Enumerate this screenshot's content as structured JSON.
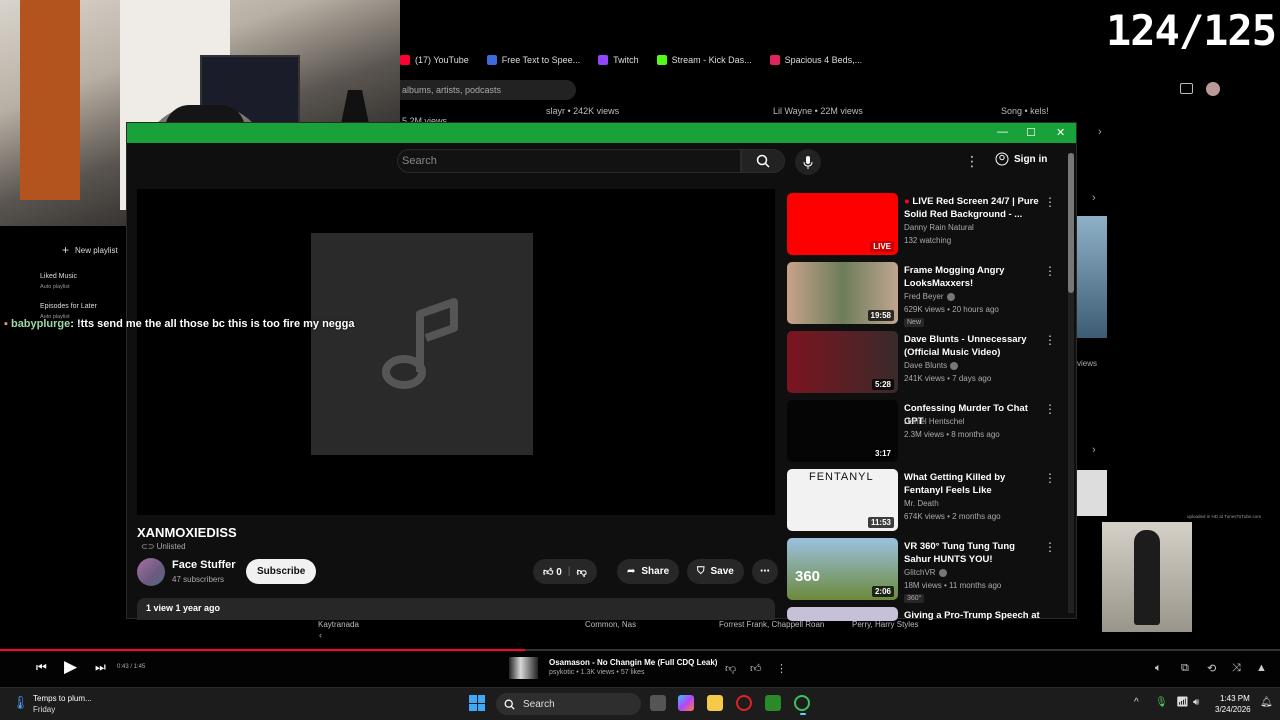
{
  "counter": "124/125",
  "bookmarks": [
    {
      "label": "(17) YouTube",
      "color": "#ff0033"
    },
    {
      "label": "Free Text to Spee...",
      "color": "#3d6bd9"
    },
    {
      "label": "Twitch",
      "color": "#9146ff"
    },
    {
      "label": "Stream - Kick Das...",
      "color": "#53fc18"
    },
    {
      "label": "Spacious 4 Beds,...",
      "color": "#e0245e"
    }
  ],
  "bg_search_placeholder": "albums, artists, podcasts",
  "bg_strip": [
    "slayr • 242K views",
    "Lil Wayne • 22M views",
    "Song • kels!",
    "5.2M views"
  ],
  "window": {
    "search_placeholder": "Search",
    "signin": "Sign in"
  },
  "video": {
    "title": "XANMOXIEDISS",
    "visibility": "Unlisted",
    "channel": "Face Stuffer",
    "subscribers": "47 subscribers",
    "subscribe": "Subscribe",
    "likes": "0",
    "share": "Share",
    "save": "Save",
    "description": "1 view  1 year ago"
  },
  "recommendations": [
    {
      "title": "LIVE Red Screen 24/7 | Pure Solid Red Background - ...",
      "channel": "Danny Rain Natural",
      "meta": "132 watching",
      "badge": "LIVE",
      "thumb": "#ff0000",
      "live": true
    },
    {
      "title": "Frame Mogging Angry LooksMaxxers!",
      "channel": "Fred Beyer",
      "verified": true,
      "meta": "629K views • 20 hours ago",
      "duration": "19:58",
      "badge": "New",
      "thumb": "#7a6a55"
    },
    {
      "title": "Dave Blunts - Unnecessary (Official Music Video)",
      "channel": "Dave Blunts",
      "verified": true,
      "meta": "241K views • 7 days ago",
      "duration": "5:28",
      "thumb": "#7c1420"
    },
    {
      "title": "Confessing Murder To Chat GPT",
      "channel": "Daniel Hentschel",
      "meta": "2.3M views • 8 months ago",
      "duration": "3:17",
      "thumb": "#0a0a0a"
    },
    {
      "title": "What Getting Killed by Fentanyl Feels Like",
      "channel": "Mr. Death",
      "meta": "674K views • 2 months ago",
      "duration": "11:53",
      "thumb": "#f2f2f2",
      "thumb_text": "FENTANYL"
    },
    {
      "title": "VR 360° Tung Tung Tung Sahur HUNTS YOU!",
      "channel": "GlitchVR",
      "verified": true,
      "meta": "18M views • 11 months ago",
      "duration": "2:06",
      "badge": "360°",
      "thumb": "#6b8a3c",
      "thumb_text": "360"
    },
    {
      "title": "Giving a Pro-Trump Speech at a ...",
      "channel": "",
      "meta": "",
      "thumb": "#c8c0d8"
    }
  ],
  "library": {
    "new_playlist": "New playlist",
    "items": [
      {
        "title": "Liked Music",
        "sub": "Auto playlist"
      },
      {
        "title": "Episodes for Later",
        "sub": "Auto playlist"
      }
    ]
  },
  "chat": {
    "user": "babyplurge",
    "message": ": !tts send me the all those bc this is too fire my negga"
  },
  "artists": [
    "Kaytranada",
    "Common, Nas",
    "Forrest Frank, Chappell Roan",
    "Perry, Harry Styles"
  ],
  "player": {
    "time": "0:43 / 1:45",
    "progress": 0.41,
    "track": "Osamason - No Changin Me (Full CDQ Leak)",
    "sub": "psykotic • 1.3K views • 57 likes"
  },
  "taskbar": {
    "weather_title": "Temps to plum...",
    "weather_sub": "Friday",
    "search": "Search",
    "time": "1:43 PM",
    "date": "3/24/2026"
  },
  "right_overlay_text": "uploaded in HD at TunesToTube.com",
  "right_views": "views"
}
